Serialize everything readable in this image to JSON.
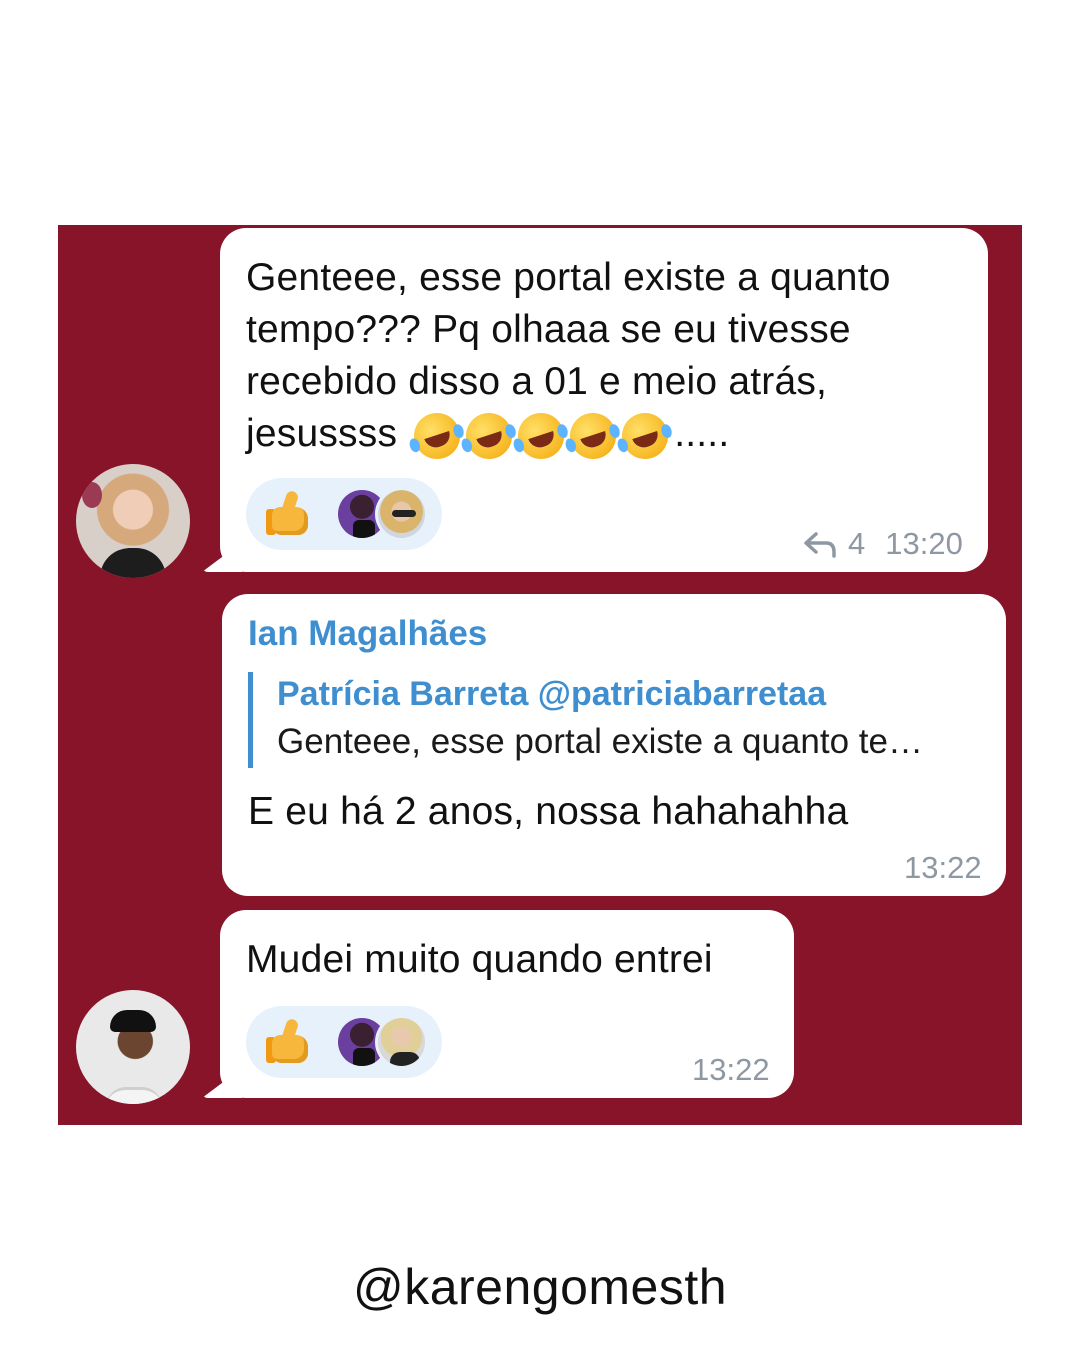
{
  "messages": [
    {
      "text": "Genteee, esse portal existe a quanto\ntempo??? Pq olhaaa se eu tivesse\nrecebido disso a 01 e meio atrás,\njesussss",
      "text_line1": "Genteee, esse portal existe a quanto",
      "text_line2": "tempo??? Pq olhaaa se eu tivesse",
      "text_line3": "recebido disso a 01 e meio atrás,",
      "text_line4": "jesussss",
      "trailing": ".....",
      "emojis": [
        "rolling-on-floor-laughing",
        "rolling-on-floor-laughing",
        "rolling-on-floor-laughing",
        "rolling-on-floor-laughing",
        "rolling-on-floor-laughing"
      ],
      "reaction_emoji": "thumbs-up",
      "reply_count": "4",
      "time": "13:20"
    },
    {
      "sender": "Ian Magalhães",
      "quote_author": "Patrícia Barreta @patriciabarretaa",
      "quote_text": "Genteee, esse portal existe a quanto te…",
      "text": "E eu há 2 anos, nossa hahahahha",
      "time": "13:22"
    },
    {
      "text": "Mudei muito quando entrei",
      "reaction_emoji": "thumbs-up",
      "time": "13:22"
    }
  ],
  "footer": {
    "handle": "@karengomesth"
  },
  "colors": {
    "panel": "#871428",
    "accent": "#3e8ed0",
    "reaction_bg": "#e7f1fb",
    "meta": "#8e98a3"
  }
}
